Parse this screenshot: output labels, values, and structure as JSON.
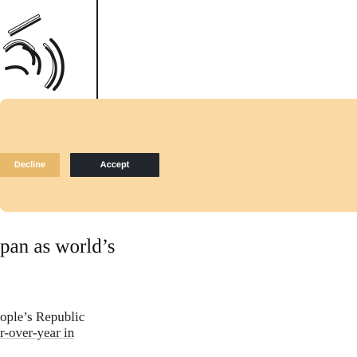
{
  "cookie_banner": {
    "decline_label": "Decline",
    "accept_label": "Accept"
  },
  "article": {
    "headline": "pan as world’s",
    "body_line_1": "ople’s Republic",
    "body_line_2": "r-over-year in"
  },
  "colors": {
    "banner_bg": "#fbd9a4",
    "decline_bg": "#e8b96a",
    "accept_bg": "#23262d"
  },
  "icons": {
    "hero": "circular-logo-illustration"
  }
}
